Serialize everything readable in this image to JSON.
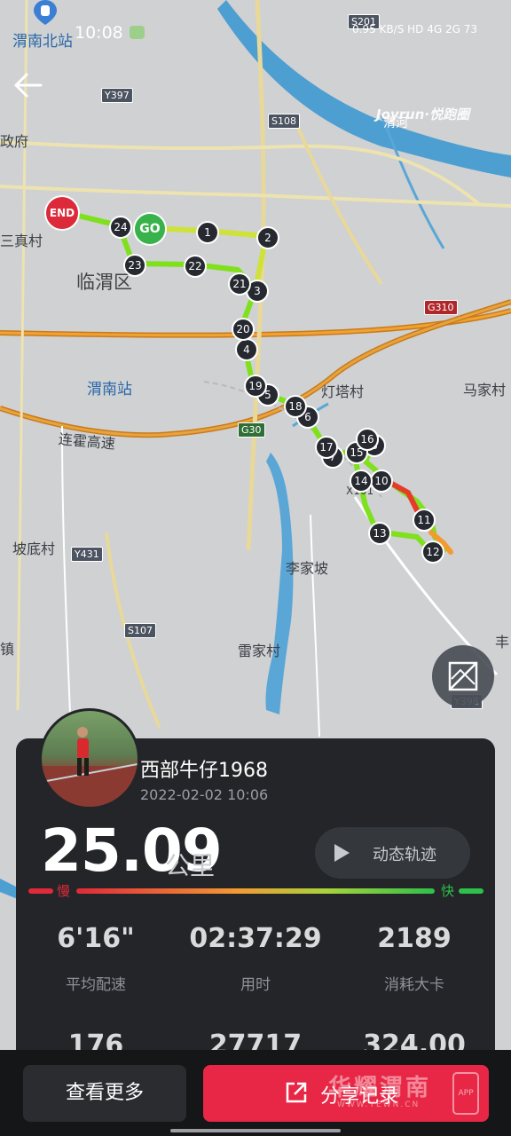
{
  "status_bar": {
    "time": "10:08",
    "right_text": "0.95 KB/S HD 4G 2G 73"
  },
  "map": {
    "brand": "Joyrun·悦跑圈",
    "labels": {
      "weinan_north_station": "渭南北站",
      "weinan_station": "渭南站",
      "linwei_district": "临渭区",
      "zhenfu": "政府",
      "sanzhen_village": "三真村",
      "dengta_village": "灯塔村",
      "majia_village": "马家村",
      "lianhuo_expressway": "连霍高速",
      "podi_village": "坡底村",
      "lijiapo": "李家坡",
      "leijia_village": "雷家村",
      "zhen": "镇",
      "feng": "丰",
      "wei_river": "渭河",
      "xl01": "X101"
    },
    "roads": {
      "s201": "S201",
      "y397": "Y397",
      "s108": "S108",
      "g310": "G310",
      "g30": "G30",
      "y431": "Y431",
      "s107": "S107",
      "y398": "Y398"
    },
    "start_label": "GO",
    "end_label": "END",
    "km_markers": [
      "1",
      "2",
      "3",
      "4",
      "5",
      "6",
      "7",
      "8",
      "9",
      "10",
      "11",
      "12",
      "13",
      "14",
      "15",
      "16",
      "17",
      "18",
      "19",
      "20",
      "21",
      "22",
      "23",
      "24"
    ],
    "colors": {
      "route_fast": "#7fe01c",
      "route_mid": "#e9e13a",
      "route_slow": "#e63a2b",
      "marker_bg": "#262930"
    }
  },
  "run": {
    "username": "西部牛仔1968",
    "datetime": "2022-02-02 10:06",
    "distance": "25.09",
    "distance_unit": "公里",
    "replay_label": "动态轨迹",
    "speed_slow": "慢",
    "speed_fast": "快",
    "stats": [
      {
        "value": "6'16\"",
        "label": "平均配速"
      },
      {
        "value": "02:37:29",
        "label": "用时"
      },
      {
        "value": "2189",
        "label": "消耗大卡"
      },
      {
        "value": "176",
        "label": ""
      },
      {
        "value": "27717",
        "label": ""
      },
      {
        "value": "324.00",
        "label": ""
      }
    ]
  },
  "actions": {
    "more": "查看更多",
    "share": "分享记录"
  },
  "watermark": {
    "main": "华耀渭南",
    "sub": "WWW.YEWN.CN",
    "app": "APP"
  }
}
